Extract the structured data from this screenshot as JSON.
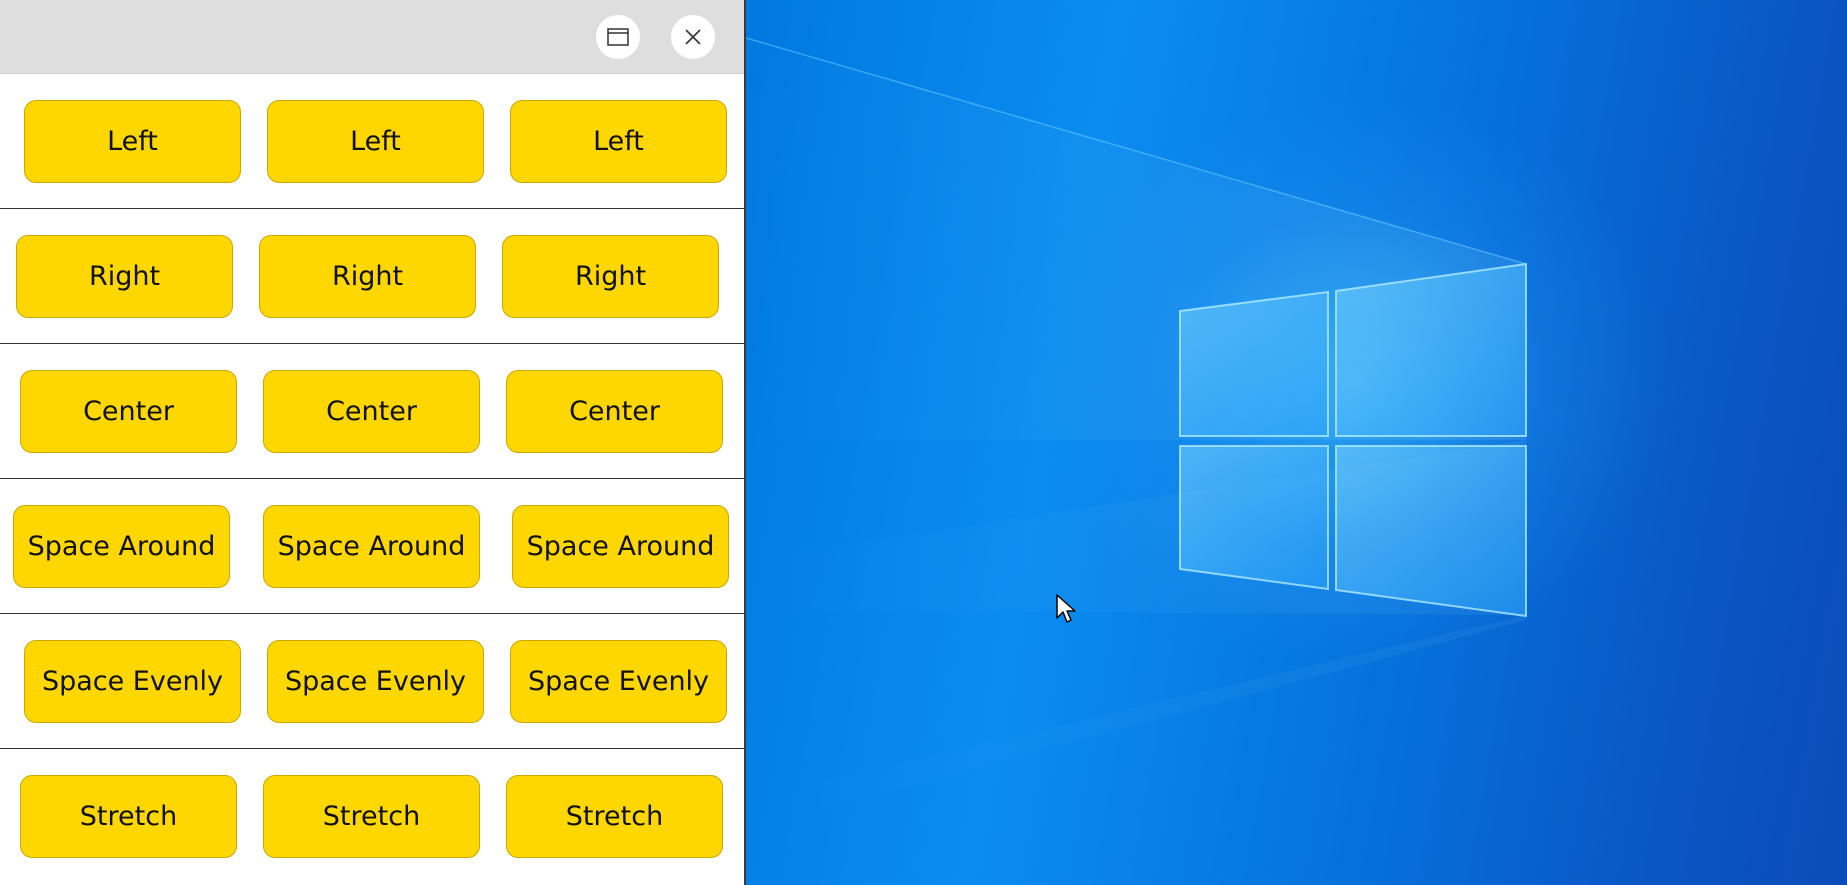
{
  "window": {
    "restore_icon": "restore-window-icon",
    "close_icon": "close-icon"
  },
  "rows": [
    {
      "name": "left",
      "buttons": [
        "Left",
        "Left",
        "Left"
      ]
    },
    {
      "name": "right",
      "buttons": [
        "Right",
        "Right",
        "Right"
      ]
    },
    {
      "name": "center",
      "buttons": [
        "Center",
        "Center",
        "Center"
      ]
    },
    {
      "name": "space-around",
      "buttons": [
        "Space Around",
        "Space Around",
        "Space Around"
      ]
    },
    {
      "name": "space-evenly",
      "buttons": [
        "Space Evenly",
        "Space Evenly",
        "Space Evenly"
      ]
    },
    {
      "name": "stretch",
      "buttons": [
        "Stretch",
        "Stretch",
        "Stretch"
      ]
    }
  ],
  "colors": {
    "button_fill": "#ffd700",
    "button_border": "#c9a800",
    "titlebar": "#dedede",
    "desktop_blue": "#0a8cf0"
  },
  "desktop": {
    "wallpaper_icon": "windows-logo-icon",
    "pointer_icon": "mouse-pointer-icon"
  }
}
